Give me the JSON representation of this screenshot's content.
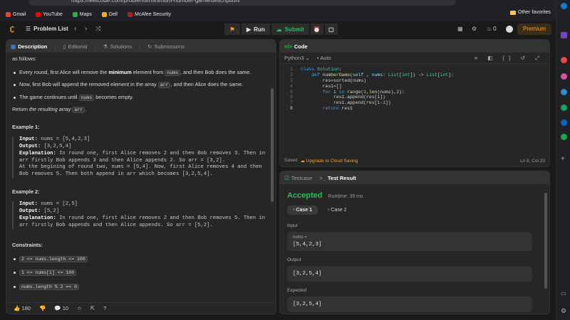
{
  "browser": {
    "url": "https://leetcode.com/problems/minimum-number-game/description/",
    "bookmarks": [
      {
        "label": "Gmail",
        "color": "#ea4335"
      },
      {
        "label": "YouTube",
        "color": "#ff0000"
      },
      {
        "label": "Maps",
        "color": "#34a853"
      },
      {
        "label": "Dell",
        "color": "#f9ab00"
      },
      {
        "label": "McAfee Security",
        "color": "#c01818"
      }
    ],
    "other_favorites": "Other favorites"
  },
  "topbar": {
    "problem_list": "Problem List",
    "run": "Run",
    "submit": "Submit",
    "streak": "0",
    "premium": "Premium"
  },
  "description": {
    "tabs": [
      "Description",
      "Editorial",
      "Solutions",
      "Submissions"
    ],
    "intro": "as follows:",
    "rules": [
      {
        "pre": "Every round, first Alice will remove the ",
        "bold": "minimum",
        "post": " element from ",
        "code": "nums",
        "post2": ", and then Bob does the same."
      },
      {
        "pre": "Now, first Bob will append the removed element in the array ",
        "code": "arr",
        "post": ", and then Alice does the same."
      },
      {
        "pre": "The game continues until ",
        "code": "nums",
        "post": " becomes empty."
      }
    ],
    "return_pre": "Return ",
    "return_em": "the resulting array",
    "return_code": "arr",
    "examples": [
      {
        "title": "Example 1:",
        "input": "nums = [5,4,2,3]",
        "output": "[3,2,5,4]",
        "explanation": "In round one, first Alice removes 2 and then Bob removes 3. Then in arr firstly Bob appends 3 and then Alice appends 2. So arr = [3,2].\nAt the begining of round two, nums = [5,4]. Now, first Alice removes 4 and then Bob removes 5. Then both append in arr which becomes [3,2,5,4]."
      },
      {
        "title": "Example 2:",
        "input": "nums = [2,5]",
        "output": "[5,2]",
        "explanation": "In round one, first Alice removes 2 and then Bob removes 5. Then in arr firstly Bob appends and then Alice appends. So arr = [5,2]."
      }
    ],
    "labels": {
      "input": "Input:",
      "output": "Output:",
      "explanation": "Explanation:"
    },
    "constraints_title": "Constraints:",
    "constraints": [
      "2 <= nums.length <= 100",
      "1 <= nums[i] <= 100",
      "nums.length % 2 == 0"
    ],
    "footer": {
      "likes": "180",
      "comments": "10"
    }
  },
  "code": {
    "tab": "Code",
    "language": "Python3",
    "auto": "Auto",
    "lines": [
      [
        [
          "kw",
          "class "
        ],
        [
          "ty",
          "Solution"
        ],
        [
          "",
          ":"
        ]
      ],
      [
        [
          "",
          "    "
        ],
        [
          "kw",
          "def "
        ],
        [
          "fn",
          "numberGame"
        ],
        [
          "",
          "("
        ],
        [
          "vr",
          "self"
        ],
        [
          "",
          " , "
        ],
        [
          "vr",
          "nums"
        ],
        [
          "",
          ": "
        ],
        [
          "ty",
          "List"
        ],
        [
          "",
          "["
        ],
        [
          "ty",
          "int"
        ],
        [
          "",
          "]) -> "
        ],
        [
          "ty",
          "List"
        ],
        [
          "",
          "["
        ],
        [
          "ty",
          "int"
        ],
        [
          "",
          "]:"
        ]
      ],
      [
        [
          "",
          "        res=sorted(nums)"
        ]
      ],
      [
        [
          "",
          "        res1=[]"
        ]
      ],
      [
        [
          "",
          "        "
        ],
        [
          "kw",
          "for "
        ],
        [
          "vr",
          "i "
        ],
        [
          "kw",
          "in "
        ],
        [
          "fn",
          "range"
        ],
        [
          "",
          "("
        ],
        [
          "nm",
          "1"
        ],
        [
          "",
          ","
        ],
        [
          "fn",
          "len"
        ],
        [
          "",
          "(nums),"
        ],
        [
          "nm",
          "2"
        ],
        [
          "",
          "):"
        ]
      ],
      [
        [
          "",
          "            res1.append(res[i])"
        ]
      ],
      [
        [
          "",
          "            res1.append(res[i-"
        ],
        [
          "nm",
          "1"
        ],
        [
          "",
          "])"
        ]
      ],
      [
        [
          "",
          "        "
        ],
        [
          "kw",
          "return "
        ],
        [
          "",
          "res1"
        ]
      ]
    ],
    "saved": "Saved",
    "upgrade": "Upgrade to Cloud Saving",
    "position": "Ln 8, Col 20"
  },
  "result": {
    "tabs": [
      "Testcase",
      "Test Result"
    ],
    "status": "Accepted",
    "runtime": "Runtime: 39 ms",
    "cases": [
      "Case 1",
      "Case 2"
    ],
    "input_label": "Input",
    "param": "nums =",
    "input_value": "[5,4,2,3]",
    "output_label": "Output",
    "output_value": "[3,2,5,4]",
    "expected_label": "Expected",
    "expected_value": "[3,2,5,4]"
  }
}
